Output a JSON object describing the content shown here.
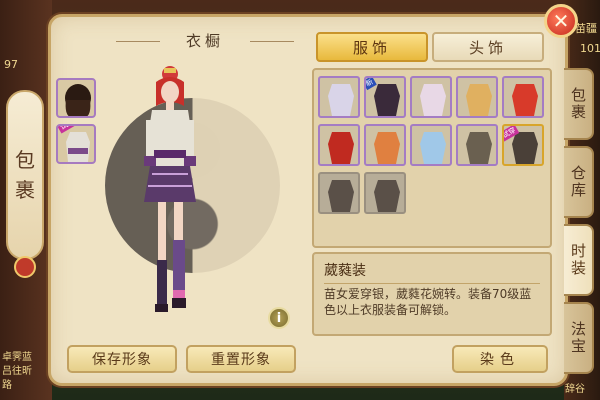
{
  "hud": {
    "top_right_name": "苗疆",
    "top_right_num": "101",
    "left_num": "97",
    "bottom_left_1": "卓霁蓝",
    "bottom_left_2": "吕往昕",
    "bottom_left_3": "路",
    "bottom_right": "辞谷"
  },
  "side_tag": {
    "label_1": "包",
    "label_2": "裹"
  },
  "panel": {
    "title": "衣橱",
    "close_label": "✕",
    "info_label": "i"
  },
  "left_slots": [
    {
      "name": "hair-slot",
      "tag": ""
    },
    {
      "name": "outfit-slot",
      "tag": "试穿"
    }
  ],
  "tabs": {
    "clothing": "服饰",
    "headwear": "头饰"
  },
  "vertical_tabs": [
    {
      "label": "包裹",
      "active": false
    },
    {
      "label": "仓库",
      "active": false
    },
    {
      "label": "时装",
      "active": true
    },
    {
      "label": "法宝",
      "active": false
    }
  ],
  "grid_items": [
    {
      "name": "outfit-item-1",
      "badge": "",
      "color": "#d9d4e8"
    },
    {
      "name": "outfit-item-2",
      "badge": "新",
      "color": "#3a2a3a"
    },
    {
      "name": "outfit-item-3",
      "badge": "",
      "color": "#e8d8e6"
    },
    {
      "name": "outfit-item-4",
      "badge": "",
      "color": "#e0b060"
    },
    {
      "name": "outfit-item-5",
      "badge": "",
      "color": "#d83a2a"
    },
    {
      "name": "outfit-item-6",
      "badge": "",
      "color": "#c02a20"
    },
    {
      "name": "outfit-item-7",
      "badge": "",
      "color": "#e08040"
    },
    {
      "name": "outfit-item-8",
      "badge": "",
      "color": "#a0c8e8"
    },
    {
      "name": "outfit-item-9",
      "badge": "",
      "color": "#6a6050"
    },
    {
      "name": "outfit-item-10",
      "badge": "试穿",
      "color": "#4a4038"
    },
    {
      "name": "outfit-item-11",
      "badge": "",
      "color": "#5a5048"
    },
    {
      "name": "outfit-item-12",
      "badge": "",
      "color": "#5a5048"
    }
  ],
  "description": {
    "title": "葳蕤装",
    "text": "苗女爱穿银，葳蕤花婉转。装备70级蓝色以上衣服装备可解锁。"
  },
  "buttons": {
    "save": "保存形象",
    "reset": "重置形象",
    "dye": "染色"
  }
}
